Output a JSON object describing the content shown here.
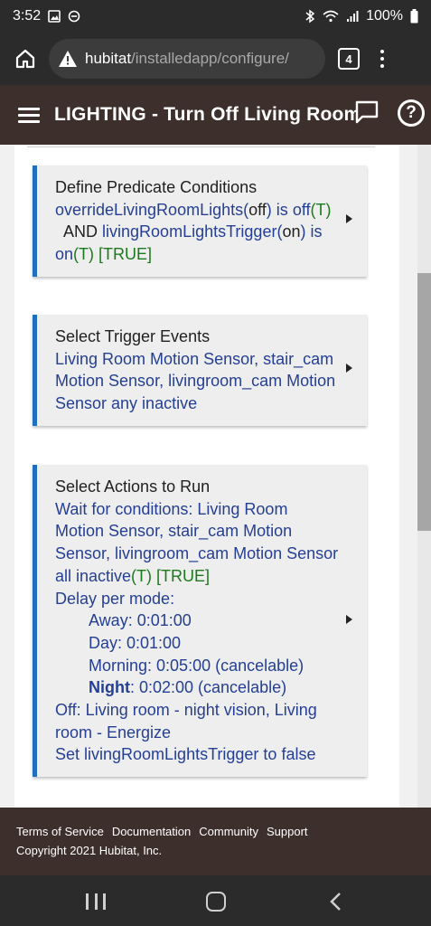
{
  "status_bar": {
    "time": "3:52",
    "battery": "100%",
    "icons": [
      "gallery-icon",
      "dnd-icon",
      "bluetooth-icon",
      "wifi-icon",
      "signal-icon",
      "battery-icon"
    ]
  },
  "browser": {
    "url_host": "hubitat",
    "url_path": "/installedapp/configure/",
    "tab_count": "4",
    "icons": [
      "home-icon",
      "warning-icon",
      "tabs-icon",
      "more-vert-icon"
    ]
  },
  "header": {
    "title": "LIGHTING - Turn Off Living Room Lights",
    "background": "#3d2f2c"
  },
  "cards": [
    {
      "title": "Define Predicate Conditions",
      "c1_a": "overrideLivingRoomLights(",
      "c1_b": "off",
      "c1_c": ") is",
      "c1_d": "off",
      "c1_e": "(T)",
      "c1_f": "  AND",
      "c1_g": "livingRoomLightsTrigger(",
      "c1_h": "on",
      "c1_i": ") is on",
      "c1_j": "(T)",
      "c1_k": "[TRUE]"
    },
    {
      "title": "Select Trigger Events",
      "body": "Living Room Motion Sensor, stair_cam Motion Sensor, livingroom_cam Motion Sensor any inactive"
    },
    {
      "title": "Select Actions to Run",
      "wait": "Wait for conditions: Living Room Motion Sensor, stair_cam Motion Sensor, livingroom_cam Motion Sensor all inactive",
      "wait_t": "(T) [TRUE]",
      "delay": "Delay per mode:",
      "away": "Away: 0:01:00",
      "day": "Day: 0:01:00",
      "morning": "Morning: 0:05:00 (cancelable)",
      "night_label": "Night",
      "night_value": ": 0:02:00 (cancelable)",
      "off": "Off: Living room - night vision, Living room - Energize",
      "set": "Set livingRoomLightsTrigger to false"
    }
  ],
  "footer": {
    "links": [
      "Terms of Service",
      "Documentation",
      "Community",
      "Support"
    ],
    "copyright": "Copyright 2021 Hubitat, Inc."
  },
  "colors": {
    "accent": "#1e6fbf",
    "link_blue": "#243f93",
    "true_green": "#1a7a1a"
  }
}
